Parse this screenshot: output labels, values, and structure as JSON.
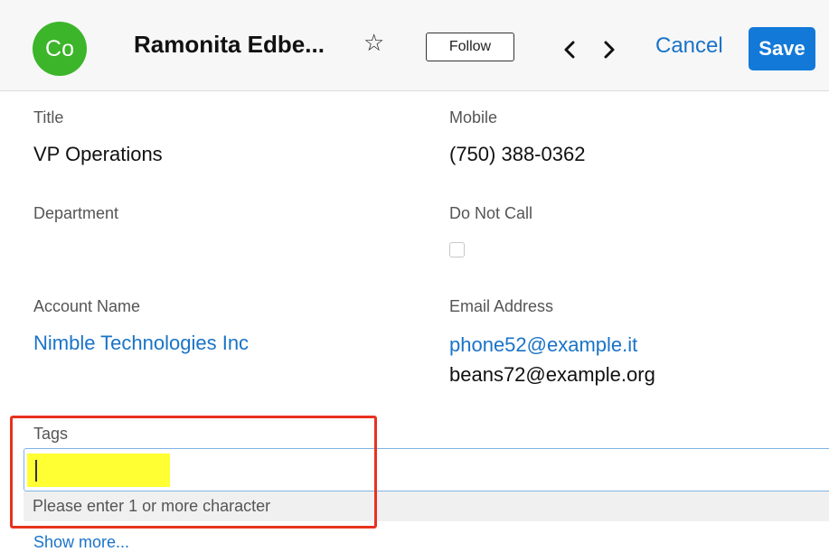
{
  "header": {
    "avatar_initials": "Co",
    "record_name": "Ramonita Edbe...",
    "favorite_icon": "star-outline-icon",
    "follow_label": "Follow",
    "previous_icon": "chevron-left-icon",
    "next_icon": "chevron-right-icon",
    "cancel_label": "Cancel",
    "save_label": "Save"
  },
  "fields": {
    "title": {
      "label": "Title",
      "value": "VP Operations"
    },
    "mobile": {
      "label": "Mobile",
      "value": "(750) 388-0362"
    },
    "department": {
      "label": "Department",
      "value": ""
    },
    "do_not_call": {
      "label": "Do Not Call",
      "checked": false
    },
    "account_name": {
      "label": "Account Name",
      "value": "Nimble Technologies Inc"
    },
    "email": {
      "label": "Email Address",
      "addresses": [
        "phone52@example.it",
        "beans72@example.org"
      ]
    },
    "tags": {
      "label": "Tags",
      "value": "",
      "hint": "Please enter 1 or more character"
    }
  },
  "show_more_label": "Show more...",
  "colors": {
    "avatar": "#3cb52a",
    "link": "#1a73c7",
    "save": "#1279d8",
    "highlight": "#ffff33",
    "callout": "#e8321d"
  }
}
